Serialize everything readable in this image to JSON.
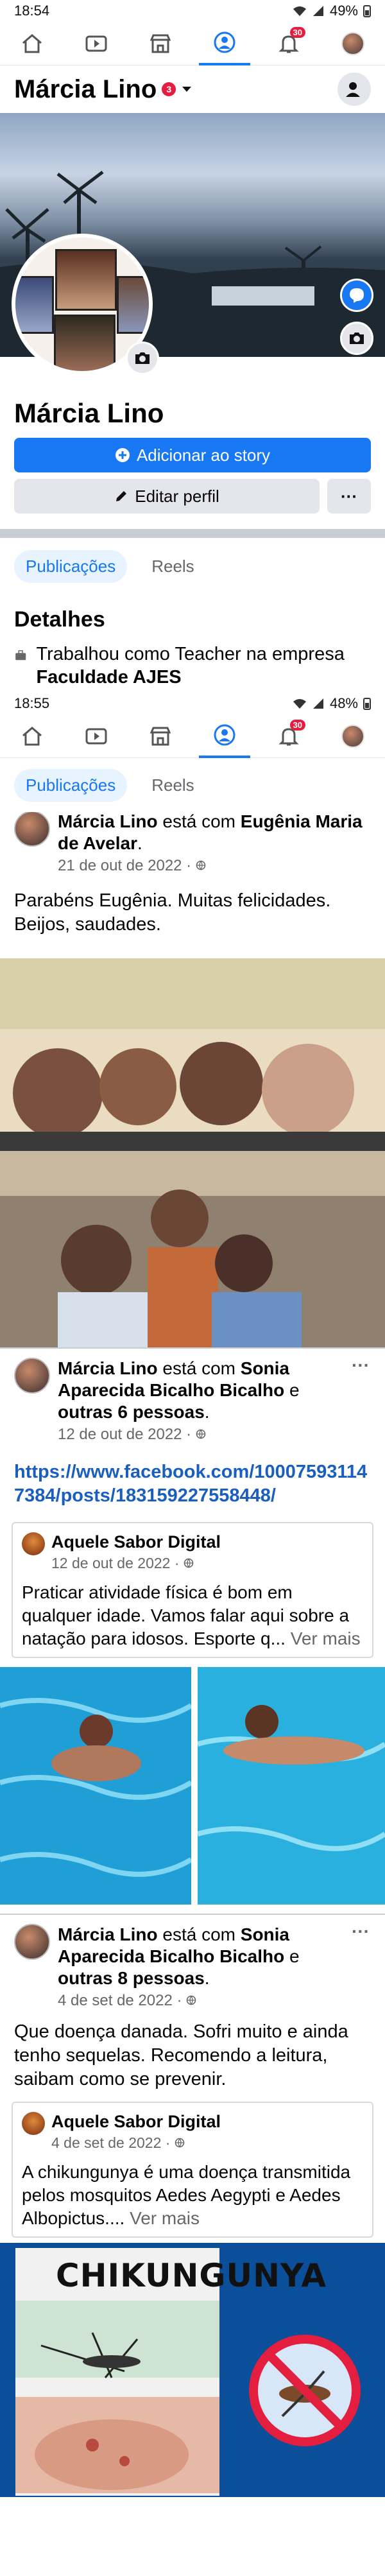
{
  "status_bar_top": {
    "time": "18:54",
    "battery": "49%"
  },
  "status_bar_mid": {
    "time": "18:55",
    "battery": "48%"
  },
  "nav": {
    "notification_count": "30"
  },
  "profile": {
    "header_name": "Márcia Lino",
    "story_count": "3",
    "name": "Márcia Lino",
    "add_story_label": "Adicionar ao story",
    "edit_profile_label": "Editar perfil",
    "more_label": "···"
  },
  "tabs": {
    "posts": "Publicações",
    "reels": "Reels"
  },
  "details": {
    "title": "Detalhes",
    "work_prefix": "Trabalhou como Teacher na empresa ",
    "work_company": "Faculdade AJES"
  },
  "post1": {
    "author": "Márcia Lino",
    "with_text": " está com ",
    "tagged": "Eugênia Maria de Avelar",
    "date": "21 de out de 2022 · ",
    "text": "Parabéns Eugênia. Muitas felicidades. Beijos, saudades."
  },
  "post2": {
    "author": "Márcia Lino",
    "with_text": " está com ",
    "tagged": "Sonia Aparecida Bicalho Bicalho",
    "and_text": " e ",
    "others": "outras 6 pessoas",
    "date": "12 de out de 2022 · ",
    "link": "https://www.facebook.com/100075931147384/posts/183159227558448/",
    "shared": {
      "page": "Aquele Sabor Digital",
      "date": "12 de out de 2022 · ",
      "text": "Praticar atividade física é bom em qualquer idade. Vamos falar aqui sobre a natação para idosos. Esporte q... ",
      "more": "Ver mais"
    }
  },
  "post3": {
    "author": "Márcia Lino",
    "with_text": " está com ",
    "tagged": "Sonia Aparecida Bicalho Bicalho",
    "and_text": " e ",
    "others": "outras 8 pessoas",
    "date": "4 de set de 2022 · ",
    "text": "Que doença danada. Sofri muito e ainda tenho sequelas. Recomendo a leitura, saibam como se prevenir.",
    "shared": {
      "page": "Aquele Sabor Digital",
      "date": "4 de set de 2022 · ",
      "text": "A chikungunya é uma doença transmitida pelos mosquitos Aedes Aegypti e Aedes Albopictus.... ",
      "more": "Ver mais"
    },
    "image_title": "CHIKUNGUNYA"
  },
  "colors": {
    "accent": "#1877f2",
    "badge": "#e41e3f",
    "link": "#1a5fbf"
  },
  "icons": [
    "home-icon",
    "video-icon",
    "marketplace-icon",
    "profile-icon",
    "bell-icon",
    "camera-icon",
    "messenger-icon",
    "pencil-icon",
    "plus-icon",
    "briefcase-icon",
    "globe-icon",
    "person-icon",
    "caret-down-icon"
  ]
}
